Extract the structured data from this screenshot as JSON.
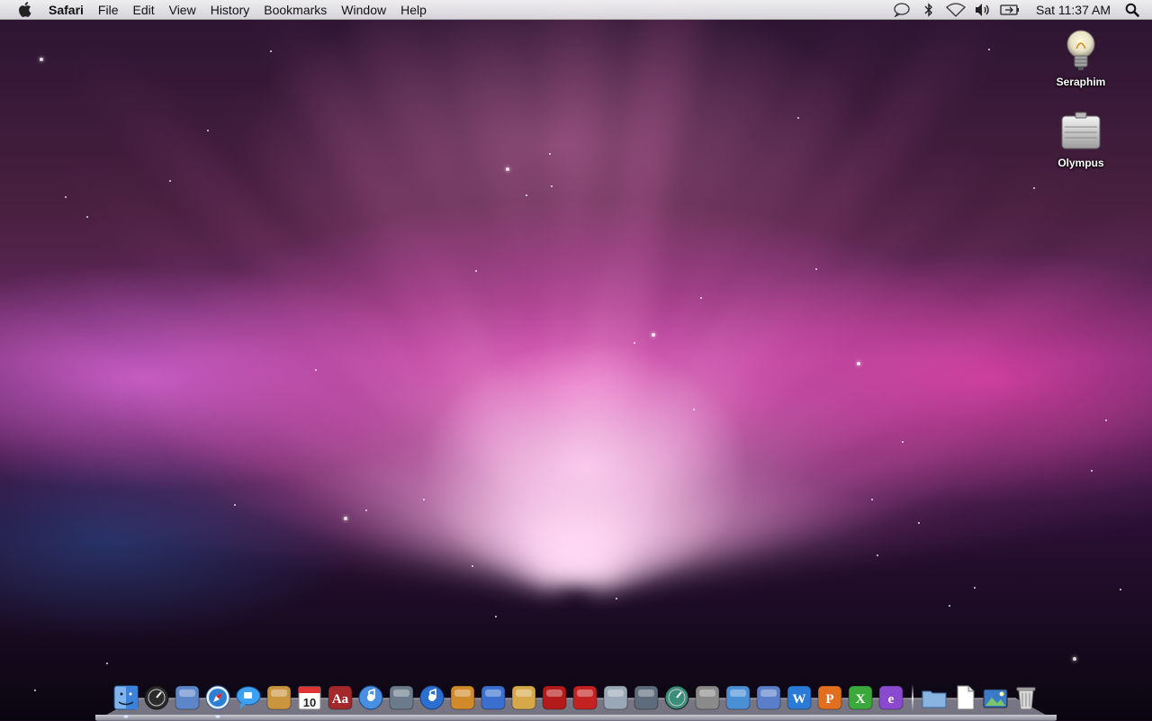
{
  "menubar": {
    "apple_icon": "apple-icon",
    "app_name": "Safari",
    "menus": [
      "File",
      "Edit",
      "View",
      "History",
      "Bookmarks",
      "Window",
      "Help"
    ],
    "status_icons": [
      "speech-bubble-icon",
      "bluetooth-icon",
      "wifi-icon",
      "volume-icon",
      "battery-icon"
    ],
    "clock": "Sat 11:37 AM",
    "spotlight_icon": "spotlight-search-icon"
  },
  "desktop": {
    "icons": [
      {
        "label": "Seraphim",
        "icon": "lightbulb-drive-icon"
      },
      {
        "label": "Olympus",
        "icon": "hard-drive-icon"
      }
    ]
  },
  "dock": {
    "apps": [
      {
        "name": "Finder",
        "icon": "finder-icon",
        "color": "#3b82d8",
        "running": true
      },
      {
        "name": "Dashboard",
        "icon": "dashboard-icon",
        "color": "#2b2b2b",
        "running": false
      },
      {
        "name": "Mail",
        "icon": "mail-icon",
        "color": "#5c86c8",
        "running": false
      },
      {
        "name": "Safari",
        "icon": "safari-icon",
        "color": "#2d7fd6",
        "running": true
      },
      {
        "name": "iChat",
        "icon": "ichat-icon",
        "color": "#3ea0f0",
        "running": false
      },
      {
        "name": "Address Book",
        "icon": "address-book-icon",
        "color": "#c9963f",
        "running": false
      },
      {
        "name": "iCal",
        "icon": "ical-icon",
        "color": "#e8e8e8",
        "day": "10",
        "running": false
      },
      {
        "name": "Dictionary",
        "icon": "dictionary-icon",
        "color": "#a2282c",
        "label": "Aa",
        "running": false
      },
      {
        "name": "iTunes",
        "icon": "itunes-icon",
        "color": "#4a90e2",
        "running": false
      },
      {
        "name": "iPhoto",
        "icon": "iphoto-icon",
        "color": "#6b7b8c",
        "running": false
      },
      {
        "name": "iDVD",
        "icon": "idvd-icon",
        "color": "#2d6fd1",
        "running": false
      },
      {
        "name": "GarageBand",
        "icon": "garageband-icon",
        "color": "#d08a2a",
        "running": false
      },
      {
        "name": "iMovie",
        "icon": "imovie-icon",
        "color": "#3a6fd0",
        "running": false
      },
      {
        "name": "iWeb",
        "icon": "iweb-icon",
        "color": "#d6a84a",
        "running": false
      },
      {
        "name": "Front Row",
        "icon": "front-row-icon",
        "color": "#b31a1a",
        "running": false
      },
      {
        "name": "Chair App",
        "icon": "red-chair-icon",
        "color": "#c42222",
        "running": false
      },
      {
        "name": "Preview",
        "icon": "preview-icon",
        "color": "#9aa7b6",
        "running": false
      },
      {
        "name": "Spaces",
        "icon": "spaces-icon",
        "color": "#5d6b7a",
        "running": false
      },
      {
        "name": "Time Machine",
        "icon": "time-machine-icon",
        "color": "#3a8e7a",
        "running": false
      },
      {
        "name": "System Preferences",
        "icon": "system-preferences-icon",
        "color": "#8a8a8a",
        "running": false
      },
      {
        "name": "Script",
        "icon": "script-icon",
        "color": "#4a8fd4",
        "running": false
      },
      {
        "name": "Pen Tool",
        "icon": "pen-tool-icon",
        "color": "#5a7fc8",
        "running": false
      },
      {
        "name": "Word",
        "icon": "word-icon",
        "color": "#2a7ad8",
        "label": "W",
        "running": false
      },
      {
        "name": "PowerPoint",
        "icon": "powerpoint-icon",
        "color": "#e07020",
        "label": "P",
        "running": false
      },
      {
        "name": "Excel",
        "icon": "excel-icon",
        "color": "#3aa83a",
        "label": "X",
        "running": false
      },
      {
        "name": "Entourage",
        "icon": "entourage-icon",
        "color": "#8a4ad0",
        "label": "e",
        "running": false
      }
    ],
    "stacks": [
      {
        "name": "Applications",
        "icon": "folder-icon",
        "color": "#8ab4e0"
      },
      {
        "name": "Documents",
        "icon": "document-icon",
        "color": "#e0e0e0"
      },
      {
        "name": "Pictures",
        "icon": "pictures-icon",
        "color": "#3a7ac8"
      },
      {
        "name": "Trash",
        "icon": "trash-icon",
        "color": "#b8b8b8"
      }
    ]
  }
}
